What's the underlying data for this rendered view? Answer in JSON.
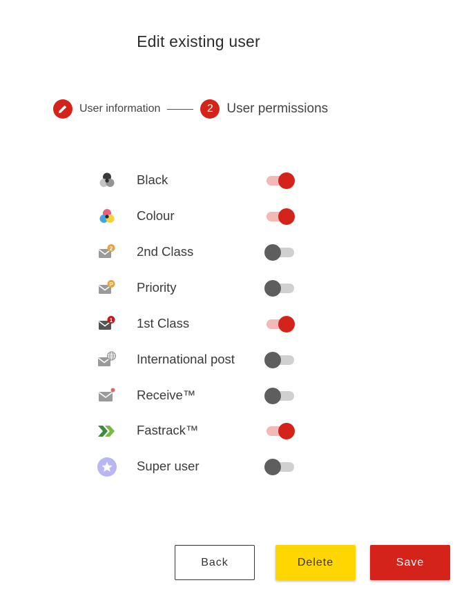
{
  "page": {
    "title": "Edit existing user"
  },
  "stepper": {
    "step1": {
      "label": "User information",
      "icon": "pencil-icon"
    },
    "step2": {
      "number": "2",
      "label": "User permissions"
    }
  },
  "permissions": [
    {
      "label": "Black",
      "icon": "black-ink-icon",
      "enabled": true
    },
    {
      "label": "Colour",
      "icon": "colour-ink-icon",
      "enabled": true
    },
    {
      "label": "2nd Class",
      "icon": "second-class-mail-icon",
      "enabled": false
    },
    {
      "label": "Priority",
      "icon": "priority-mail-icon",
      "enabled": false
    },
    {
      "label": "1st Class",
      "icon": "first-class-mail-icon",
      "enabled": true
    },
    {
      "label": "International post",
      "icon": "international-mail-icon",
      "enabled": false
    },
    {
      "label": "Receive™",
      "icon": "receive-mail-icon",
      "enabled": false
    },
    {
      "label": "Fastrack™",
      "icon": "fastrack-icon",
      "enabled": true
    },
    {
      "label": "Super user",
      "icon": "star-icon",
      "enabled": false
    }
  ],
  "buttons": {
    "back": "Back",
    "delete": "Delete",
    "save": "Save"
  },
  "colors": {
    "accent": "#d3231b",
    "delete": "#ffd600",
    "toggle_on_track": "#f3b9b6",
    "toggle_off_knob": "#5e5e5e"
  }
}
